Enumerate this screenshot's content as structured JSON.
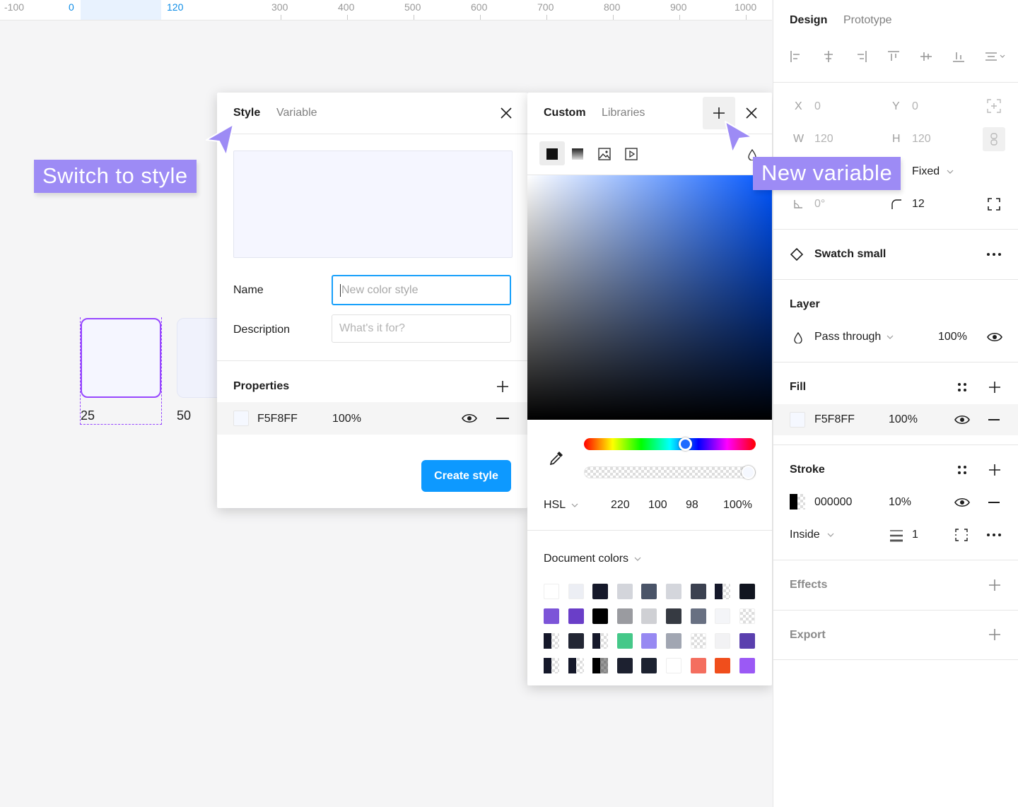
{
  "ruler": {
    "ticks": [
      "-100",
      "0",
      "120",
      "300",
      "400",
      "500",
      "600",
      "700",
      "800",
      "900",
      "1000"
    ]
  },
  "canvas": {
    "swatch_labels": [
      "25",
      "50"
    ],
    "callout_style": "Switch to style",
    "callout_variable": "New variable"
  },
  "style_panel": {
    "tabs": [
      "Style",
      "Variable"
    ],
    "name_label": "Name",
    "name_placeholder": "New color style",
    "description_label": "Description",
    "description_placeholder": "What's it for?",
    "properties_label": "Properties",
    "fill_hex": "F5F8FF",
    "fill_opacity": "100%",
    "create_button": "Create style"
  },
  "color_picker": {
    "tabs": [
      "Custom",
      "Libraries"
    ],
    "mode": "HSL",
    "values": [
      "220",
      "100",
      "98",
      "100%"
    ],
    "hue_position": 0.6,
    "alpha_position": 1.0,
    "document_colors_label": "Document colors",
    "palette": [
      [
        "#ffffff",
        "#eceef4",
        "#15182a",
        "#d3d5db",
        "#4a5468",
        "#d4d6dc",
        "#3b4150",
        "split",
        "#111520"
      ],
      [
        "#7c54d8",
        "#6a3ec8",
        "#000000",
        "#9a9ba0",
        "#cfd0d4",
        "#363a42",
        "#687082",
        "#f4f5f8",
        "checker"
      ],
      [
        "split",
        "#222634",
        "split",
        "#45c889",
        "#9789f2",
        "#a1a6b2",
        "checker",
        "#f2f2f4",
        "#5a3fae"
      ],
      [
        "split",
        "split",
        "splitgrey",
        "#1d2130",
        "#1c2230",
        "#ffffff",
        "#f46e5f",
        "#f04e1c",
        "#9b59f5"
      ]
    ]
  },
  "design_panel": {
    "tabs": [
      "Design",
      "Prototype"
    ],
    "x_label": "X",
    "x_value": "0",
    "y_label": "Y",
    "y_value": "0",
    "w_label": "W",
    "w_value": "120",
    "h_label": "H",
    "h_value": "120",
    "resize_value": "Fixed",
    "rotation": "0°",
    "radius": "12",
    "component_name": "Swatch small",
    "layer_title": "Layer",
    "blend_mode": "Pass through",
    "layer_opacity": "100%",
    "fill_title": "Fill",
    "fill_hex": "F5F8FF",
    "fill_opacity": "100%",
    "stroke_title": "Stroke",
    "stroke_hex": "000000",
    "stroke_opacity": "10%",
    "stroke_position": "Inside",
    "stroke_weight": "1",
    "effects_title": "Effects",
    "export_title": "Export"
  }
}
